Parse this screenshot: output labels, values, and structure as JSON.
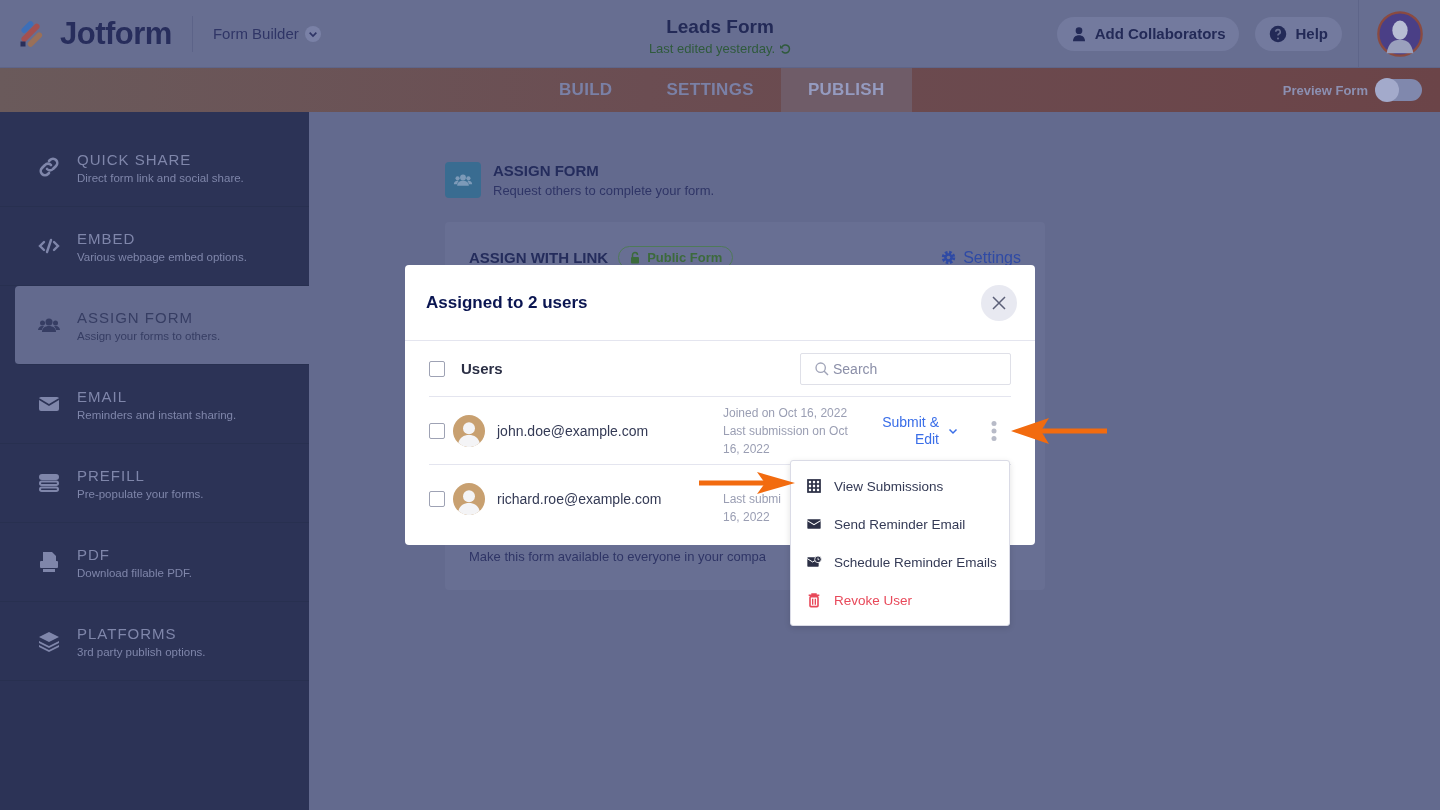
{
  "header": {
    "logo": "Jotform",
    "product": "Form Builder",
    "title": "Leads Form",
    "subtitle": "Last edited yesterday.",
    "buttons": [
      {
        "label": "Add Collaborators",
        "kind": "user"
      },
      {
        "label": "Help",
        "kind": "help"
      }
    ]
  },
  "nav": {
    "tabs": [
      {
        "label": "BUILD",
        "selected": false
      },
      {
        "label": "SETTINGS",
        "selected": false
      },
      {
        "label": "PUBLISH",
        "selected": true
      }
    ],
    "preview": {
      "label": "Preview Form",
      "on": false
    }
  },
  "sidebar": {
    "items": [
      {
        "title": "QUICK SHARE",
        "subtitle": "Direct form link and social share.",
        "kind": "link",
        "selected": false
      },
      {
        "title": "EMBED",
        "subtitle": "Various webpage embed options.",
        "kind": "code",
        "selected": false
      },
      {
        "title": "ASSIGN FORM",
        "subtitle": "Assign your forms to others.",
        "kind": "group",
        "selected": true
      },
      {
        "title": "EMAIL",
        "subtitle": "Reminders and instant sharing.",
        "kind": "mail",
        "selected": false
      },
      {
        "title": "PREFILL",
        "subtitle": "Pre-populate your forms.",
        "kind": "prefill",
        "selected": false
      },
      {
        "title": "PDF",
        "subtitle": "Download fillable PDF.",
        "kind": "pdf",
        "selected": false
      },
      {
        "title": "PLATFORMS",
        "subtitle": "3rd party publish options.",
        "kind": "layers",
        "selected": false
      }
    ]
  },
  "page": {
    "title": "ASSIGN FORM",
    "subtitle": "Request others to complete your form."
  },
  "card": {
    "title": "ASSIGN WITH LINK",
    "badge": "Public Form",
    "settings": "Settings",
    "footer": "Make this form available to everyone in your compa"
  },
  "modal": {
    "title": "Assigned to 2 users",
    "column": "Users",
    "all_checked": false,
    "search": {
      "placeholder": "Search"
    },
    "rows": [
      {
        "email": "john.doe@example.com",
        "checked": false,
        "meta": [
          "Joined on Oct 16, 2022",
          "Last submission on Oct 16, 2022"
        ],
        "action": "Submit & Edit"
      },
      {
        "email": "richard.roe@example.com",
        "checked": false,
        "meta": [
          "Last submi",
          "16, 2022"
        ]
      }
    ]
  },
  "menu": {
    "items": [
      {
        "label": "View Submissions",
        "kind": "grid",
        "danger": false
      },
      {
        "label": "Send Reminder Email",
        "kind": "mail",
        "danger": false
      },
      {
        "label": "Schedule Reminder Emails",
        "kind": "schedule",
        "danger": false
      },
      {
        "label": "Revoke User",
        "kind": "trash",
        "danger": true
      }
    ]
  }
}
